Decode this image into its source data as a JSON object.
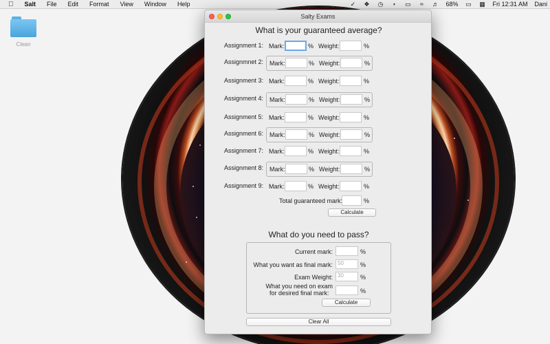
{
  "menubar": {
    "apple": "",
    "app_name": "Salt",
    "menus": [
      "File",
      "Edit",
      "Format",
      "View",
      "Window",
      "Help"
    ],
    "battery": "68%",
    "clock": "Fri 12:31 AM",
    "user": "Dani"
  },
  "desktop": {
    "folder_label": "Clean"
  },
  "window": {
    "title": "Salty Exams",
    "section1_title": "What is your guaranteed average?",
    "mark_label": "Mark:",
    "weight_label": "Weight:",
    "percent": "%",
    "assignments": [
      {
        "label": "Assignment 1:",
        "mark": "",
        "weight": ""
      },
      {
        "label": "Assignmnet 2:",
        "mark": "",
        "weight": ""
      },
      {
        "label": "Assignment 3:",
        "mark": "",
        "weight": ""
      },
      {
        "label": "Assignment 4:",
        "mark": "",
        "weight": ""
      },
      {
        "label": "Assignment 5:",
        "mark": "",
        "weight": ""
      },
      {
        "label": "Assignment 6:",
        "mark": "",
        "weight": ""
      },
      {
        "label": "Assignment 7:",
        "mark": "",
        "weight": ""
      },
      {
        "label": "Assignment 8:",
        "mark": "",
        "weight": ""
      },
      {
        "label": "Assignment 9:",
        "mark": "",
        "weight": ""
      }
    ],
    "total_label": "Total guaranteed mark:",
    "total_value": "",
    "calculate_label": "Calculate",
    "section2_title": "What do you need to pass?",
    "current_mark_label": "Current mark:",
    "current_mark_value": "",
    "final_mark_label": "What you want as final mark:",
    "final_mark_placeholder": "50",
    "exam_weight_label": "Exam Weight:",
    "exam_weight_placeholder": "30",
    "need_label_line1": "What you need on exam",
    "need_label_line2": "for desired final mark:",
    "need_value": "",
    "calculate2_label": "Calculate",
    "clear_all_label": "Clear All"
  }
}
